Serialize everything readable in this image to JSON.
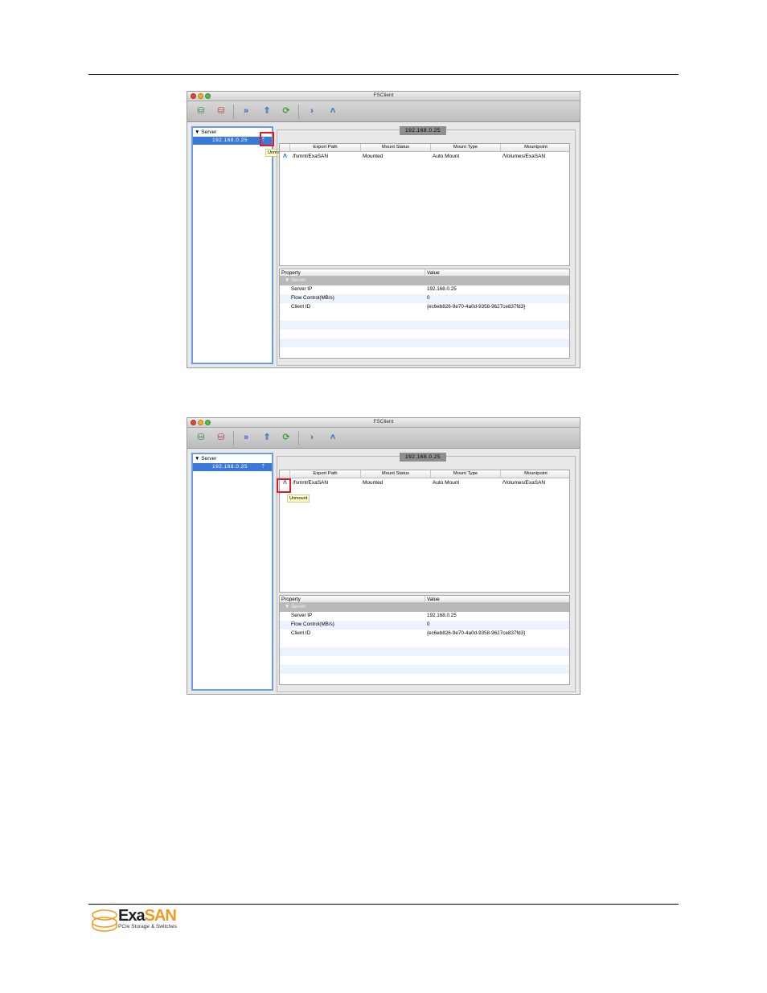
{
  "screenshots": [
    {
      "window_title": "FSClient",
      "sidebar": {
        "header": "Server",
        "item": "192.168.0.25",
        "item_icon": "unmount-all-icon"
      },
      "tooltip": "Unmount All",
      "group_title": "192.168.0.25",
      "mount_table": {
        "columns": [
          "Export Path",
          "Mount Status",
          "Mount Type",
          "Mountpoint"
        ],
        "rows": [
          {
            "export_path": "/fsmnt/ExaSAN",
            "mount_status": "Mounted",
            "mount_type": "Auto Mount",
            "mountpoint": "/Volumes/ExaSAN"
          }
        ]
      },
      "property_table": {
        "columns": [
          "Property",
          "Value"
        ],
        "group": "Server",
        "rows": [
          {
            "property": "Server IP",
            "value": "192.168.0.25"
          },
          {
            "property": "Flow Control(MB/s)",
            "value": "0"
          },
          {
            "property": "Client ID",
            "value": "{ec6eb826-9e70-4a0d-9358-9627ce837fd3}"
          }
        ]
      }
    },
    {
      "window_title": "FSClient",
      "sidebar": {
        "header": "Server",
        "item": "192.168.0.25",
        "item_icon": "unmount-all-icon"
      },
      "tooltip": "Unmount",
      "group_title": "192.168.0.25",
      "mount_table": {
        "columns": [
          "Export Path",
          "Mount Status",
          "Mount Type",
          "Mountpoint"
        ],
        "rows": [
          {
            "export_path": "/fsmnt/ExaSAN",
            "mount_status": "Mounted",
            "mount_type": "Auto Mount",
            "mountpoint": "/Volumes/ExaSAN"
          }
        ]
      },
      "property_table": {
        "columns": [
          "Property",
          "Value"
        ],
        "group": "Server",
        "rows": [
          {
            "property": "Server IP",
            "value": "192.168.0.25"
          },
          {
            "property": "Flow Control(MB/s)",
            "value": "0"
          },
          {
            "property": "Client ID",
            "value": "{ec6eb826-9e70-4a0d-9358-9627ce837fd3}"
          }
        ]
      }
    }
  ],
  "footer": {
    "brand_a": "Exa",
    "brand_b": "SAN",
    "tagline": "PCIe Storage & Switches"
  },
  "colors": {
    "brand_orange": "#f39a1e",
    "selection_blue": "#3b78d8",
    "highlight_red": "#e01b24"
  }
}
